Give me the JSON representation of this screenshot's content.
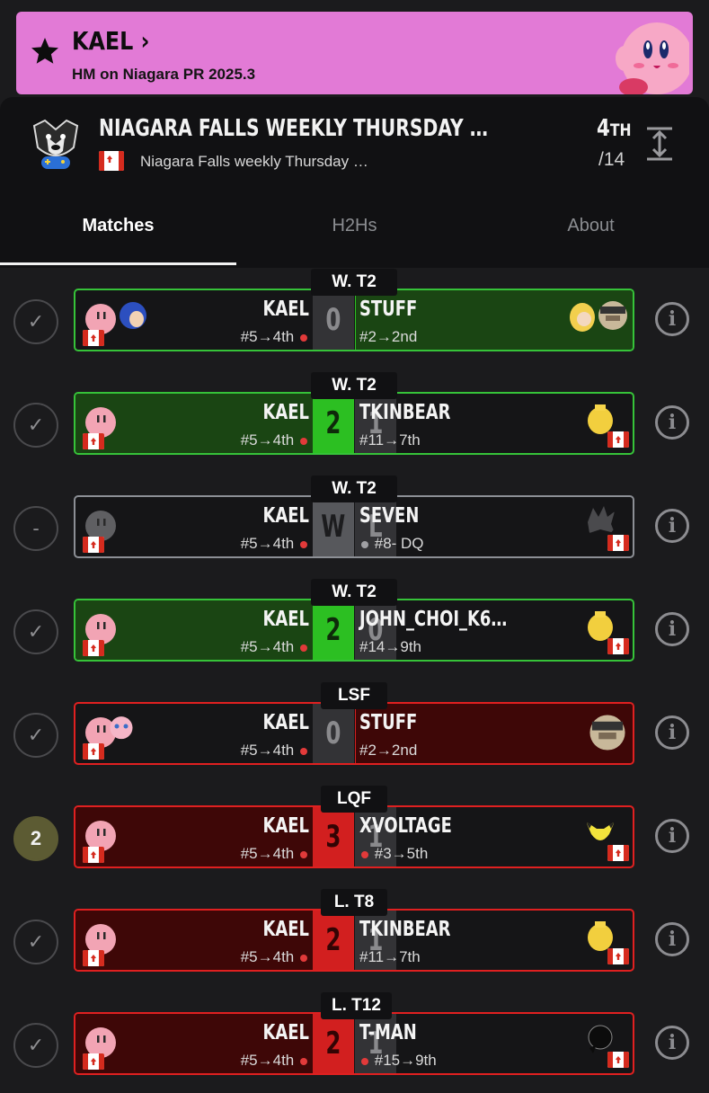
{
  "banner": {
    "player": "KAEL",
    "subtitle": "HM on Niagara PR 2025.3",
    "chevron": "›"
  },
  "tournament": {
    "title": "NIAGARA FALLS WEEKLY THURSDAY …",
    "subtitle": "Niagara Falls weekly Thursday …",
    "placing": "4",
    "placing_suffix": "TH",
    "entrants": "/14"
  },
  "tabs": [
    {
      "label": "Matches"
    },
    {
      "label": "H2Hs"
    },
    {
      "label": "About"
    }
  ],
  "matches": [
    {
      "round": "W. T2",
      "status": "✓",
      "left_name": "KAEL",
      "left_seed": "#5→4th",
      "left_score": "0",
      "right_name": "STUFF",
      "right_seed": "#2→2nd",
      "right_score": "2"
    },
    {
      "round": "W. T2",
      "status": "✓",
      "left_name": "KAEL",
      "left_seed": "#5→4th",
      "left_score": "2",
      "right_name": "TKINBEAR",
      "right_seed": "#11→7th",
      "right_score": "1"
    },
    {
      "round": "W. T2",
      "status": "-",
      "left_name": "KAEL",
      "left_seed": "#5→4th",
      "left_score": "W",
      "right_name": "SEVEN",
      "right_seed": "#8- DQ",
      "right_score": "L"
    },
    {
      "round": "W. T2",
      "status": "✓",
      "left_name": "KAEL",
      "left_seed": "#5→4th",
      "left_score": "2",
      "right_name": "JOHN_CHOI_K6…",
      "right_seed": "#14→9th",
      "right_score": "0"
    },
    {
      "round": "LSF",
      "status": "✓",
      "left_name": "KAEL",
      "left_seed": "#5→4th",
      "left_score": "0",
      "right_name": "STUFF",
      "right_seed": "#2→2nd",
      "right_score": "3"
    },
    {
      "round": "LQF",
      "status": "2",
      "left_name": "KAEL",
      "left_seed": "#5→4th",
      "left_score": "3",
      "right_name": "XVOLTAGE",
      "right_seed": "#3→5th",
      "right_score": "1"
    },
    {
      "round": "L. T8",
      "status": "✓",
      "left_name": "KAEL",
      "left_seed": "#5→4th",
      "left_score": "2",
      "right_name": "TKINBEAR",
      "right_seed": "#11→7th",
      "right_score": "1"
    },
    {
      "round": "L. T12",
      "status": "✓",
      "left_name": "KAEL",
      "left_seed": "#5→4th",
      "left_score": "2",
      "right_name": "T-MAN",
      "right_seed": "#15→9th",
      "right_score": "1"
    }
  ],
  "info_glyph": "i",
  "colors": {
    "banner": "#e27ad6",
    "win": "#2cbf22",
    "loss": "#d21f1f",
    "background": "#1b1b1d"
  }
}
